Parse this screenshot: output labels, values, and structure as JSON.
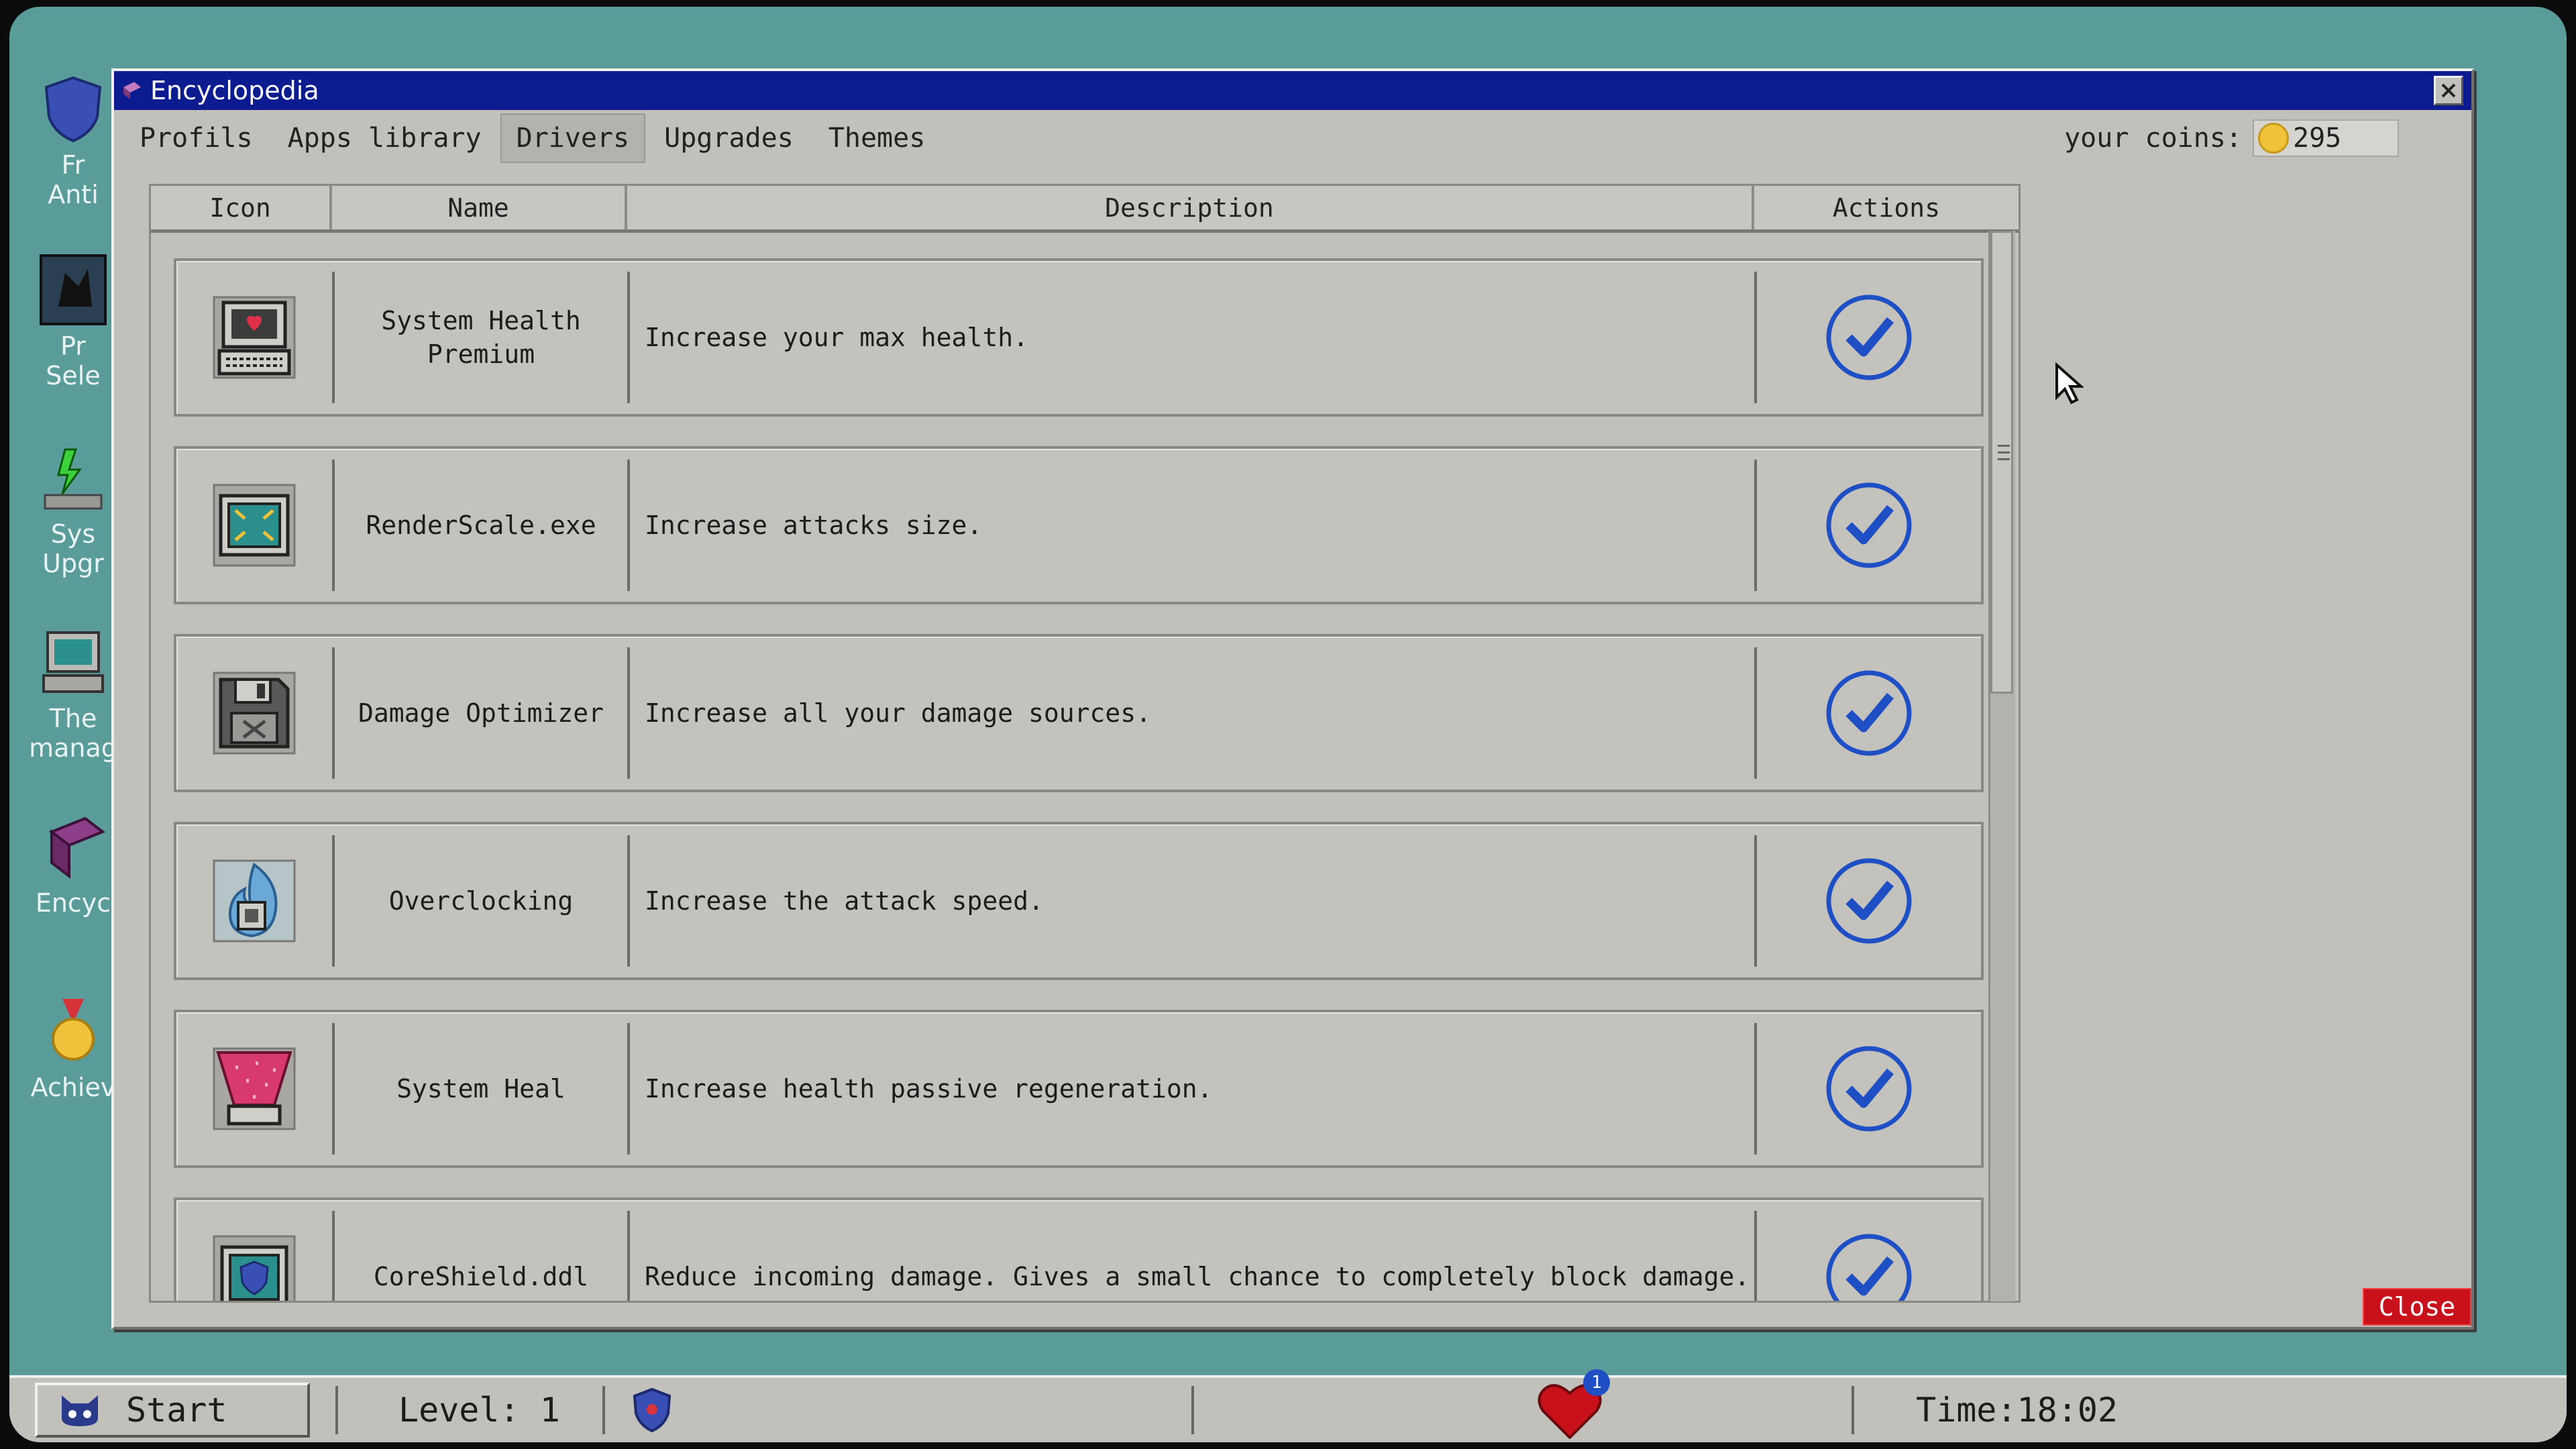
{
  "desktop": {
    "icons": [
      {
        "label1": "Fr",
        "label2": "Anti",
        "icon": "shield-app-icon"
      },
      {
        "label1": "Pr",
        "label2": "Sele",
        "icon": "profile-cat-icon"
      },
      {
        "label1": "Sys",
        "label2": "Upgr",
        "icon": "system-upgrade-icon"
      },
      {
        "label1": "The",
        "label2": "manag",
        "icon": "theme-manager-icon"
      },
      {
        "label1": "",
        "label2": "Encyc",
        "icon": "book-icon"
      },
      {
        "label1": "",
        "label2": "Achiev",
        "icon": "medal-icon"
      }
    ]
  },
  "window": {
    "title": "Encyclopedia",
    "menu": [
      "Profils",
      "Apps library",
      "Drivers",
      "Upgrades",
      "Themes"
    ],
    "active_menu": "Drivers",
    "coins_label": "your coins:",
    "coins_value": "295",
    "close_label": "Close"
  },
  "table": {
    "headers": {
      "icon": "Icon",
      "name": "Name",
      "description": "Description",
      "actions": "Actions"
    },
    "rows": [
      {
        "name": "System Health Premium",
        "description": "Increase your max health.",
        "icon": "health-monitor-icon"
      },
      {
        "name": "RenderScale.exe",
        "description": "Increase attacks size.",
        "icon": "render-scale-icon"
      },
      {
        "name": "Damage Optimizer",
        "description": "Increase all your damage sources.",
        "icon": "floppy-disk-icon"
      },
      {
        "name": "Overclocking",
        "description": "Increase the attack speed.",
        "icon": "flame-chip-icon"
      },
      {
        "name": "System Heal",
        "description": "Increase health passive regeneration.",
        "icon": "heal-beam-icon"
      },
      {
        "name": "CoreShield.ddl",
        "description": "Reduce incoming damage. Gives a small chance to completely block damage.",
        "icon": "core-shield-icon"
      }
    ]
  },
  "taskbar": {
    "start_label": "Start",
    "level_label": "Level: 1",
    "heart_badge": "1",
    "time_label": "Time:18:02"
  },
  "colors": {
    "desktop_bg": "#5a9c9a",
    "titlebar": "#0c1b8f",
    "check_blue": "#1f4fc4",
    "close_red": "#c8111b"
  }
}
